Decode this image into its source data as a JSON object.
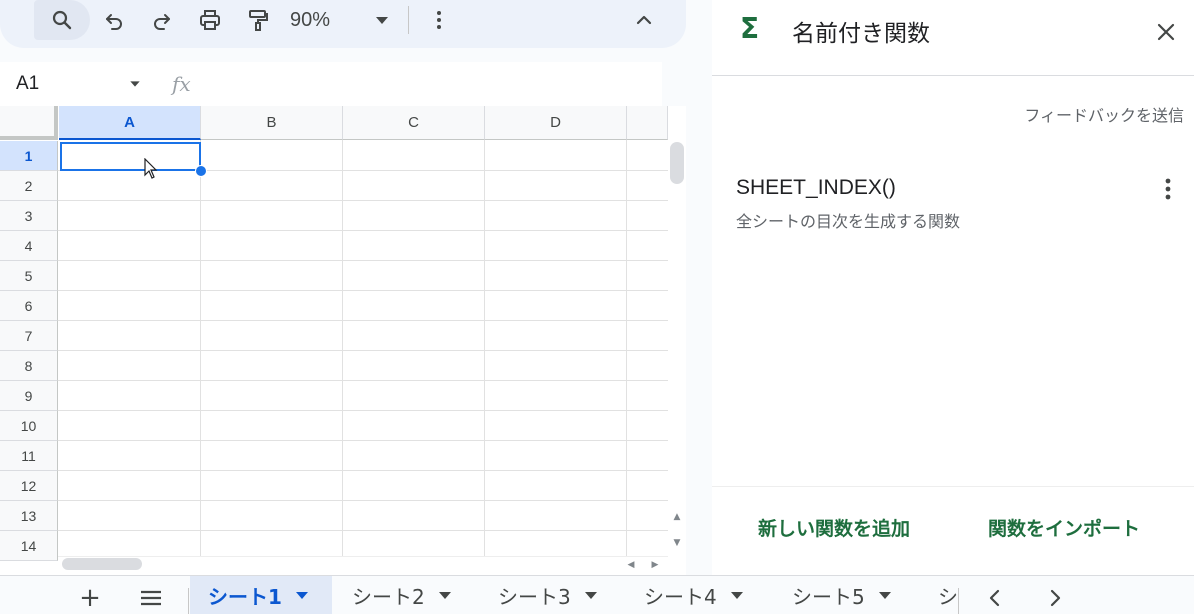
{
  "toolbar": {
    "zoom": "90%",
    "icons": [
      "search-icon",
      "undo-icon",
      "redo-icon",
      "print-icon",
      "paint-format-icon",
      "dropdown-caret-icon",
      "more-vert-icon",
      "chevron-up-icon"
    ]
  },
  "formula_bar": {
    "cell_reference": "A1",
    "fx": "fx",
    "value": ""
  },
  "grid": {
    "columns": [
      "A",
      "B",
      "C",
      "D"
    ],
    "rows": [
      "1",
      "2",
      "3",
      "4",
      "5",
      "6",
      "7",
      "8",
      "9",
      "10",
      "11",
      "12",
      "13",
      "14"
    ],
    "selected_cell": "A1"
  },
  "panel": {
    "title": "名前付き関数",
    "feedback": "フィードバックを送信",
    "functions": [
      {
        "name": "SHEET_INDEX()",
        "description": "全シートの目次を生成する関数"
      }
    ],
    "add_button": "新しい関数を追加",
    "import_button": "関数をインポート",
    "accent_color": "#1e6e3e"
  },
  "sheets": {
    "tabs": [
      "シート1",
      "シート2",
      "シート3",
      "シート4",
      "シート5",
      "シ"
    ],
    "active_index": 0,
    "add_label": "+"
  }
}
